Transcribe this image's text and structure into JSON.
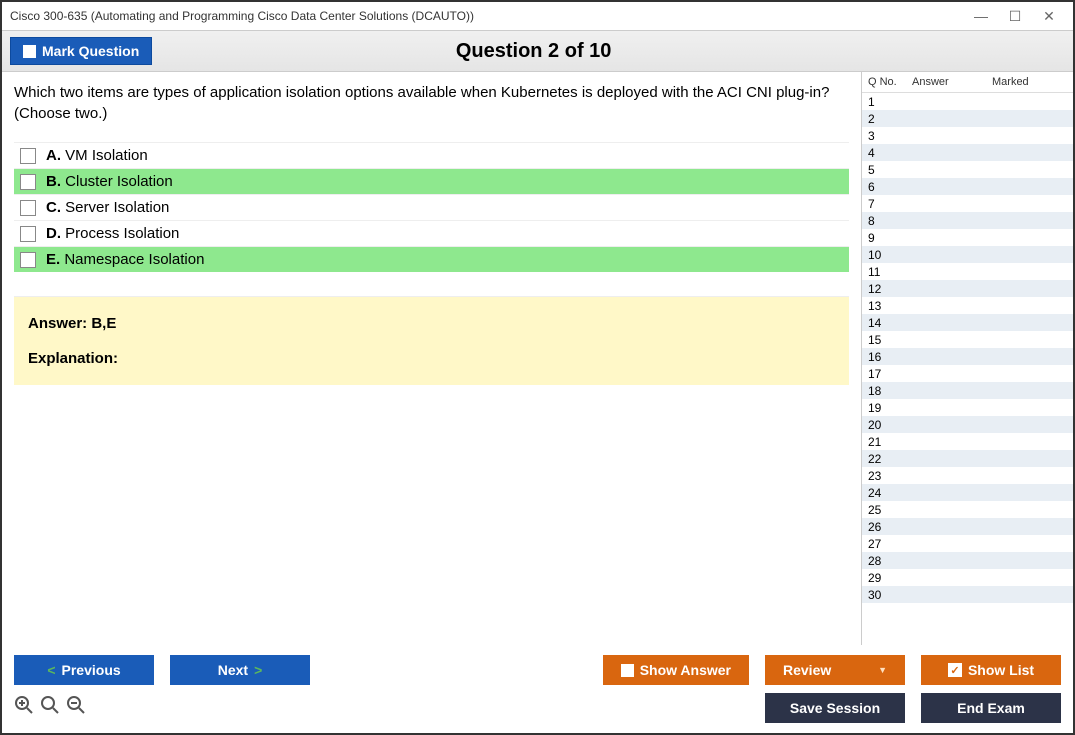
{
  "window": {
    "title": "Cisco 300-635 (Automating and Programming Cisco Data Center Solutions (DCAUTO))"
  },
  "topbar": {
    "mark_label": "Mark Question",
    "question_title": "Question 2 of 10"
  },
  "question": {
    "text": "Which two items are types of application isolation options available when Kubernetes is deployed with the ACI CNI plug-in? (Choose two.)",
    "options": [
      {
        "letter": "A.",
        "text": "VM Isolation",
        "highlight": false
      },
      {
        "letter": "B.",
        "text": "Cluster Isolation",
        "highlight": true
      },
      {
        "letter": "C.",
        "text": "Server Isolation",
        "highlight": false
      },
      {
        "letter": "D.",
        "text": "Process Isolation",
        "highlight": false
      },
      {
        "letter": "E.",
        "text": "Namespace Isolation",
        "highlight": true
      }
    ]
  },
  "answer_box": {
    "answer_label": "Answer: B,E",
    "explain_label": "Explanation:"
  },
  "sidebar": {
    "headers": {
      "qno": "Q No.",
      "answer": "Answer",
      "marked": "Marked"
    },
    "count": 30
  },
  "footer": {
    "previous": "Previous",
    "next": "Next",
    "show_answer": "Show Answer",
    "review": "Review",
    "show_list": "Show List",
    "save_session": "Save Session",
    "end_exam": "End Exam"
  }
}
